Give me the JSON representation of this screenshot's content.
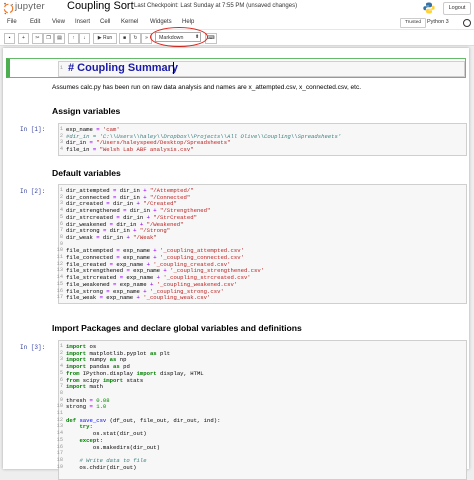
{
  "header": {
    "logo_text": "jupyter",
    "notebook_name": "Coupling Sort",
    "checkpoint": "Last Checkpoint: Last Sunday at 7:55 PM  (unsaved changes)",
    "logout": "Logout"
  },
  "menubar": {
    "items": [
      "File",
      "Edit",
      "View",
      "Insert",
      "Cell",
      "Kernel",
      "Widgets",
      "Help"
    ],
    "trusted": "Trusted",
    "kernel": "Python 3"
  },
  "toolbar": {
    "run_label": "Run",
    "cell_type": "Markdown",
    "highlight_color": "#d9261c"
  },
  "cells": {
    "title": "# Coupling Summary",
    "intro": "Assumes calc.py has been run on raw data analysis and names are x_attempted.csv, x_connected.csv, etc.",
    "h_assign": "Assign variables",
    "h_default": "Default variables",
    "h_import": "Import Packages and declare global variables and definitions",
    "prompt1": "In [1]:",
    "prompt2": "In [2]:",
    "prompt3": "In [3]:",
    "code1": [
      "exp_name = 'cam'",
      "#dir_in = 'C:\\\\Users\\\\haley\\\\Dropbox\\\\Projects\\\\All Olive\\\\Coupling\\\\Spreadsheets'",
      "dir_in = \"/Users/haleyspeed/Desktop/Spreadsheets\"",
      "file_in = \"Welsh Lab ABF analysis.csv\""
    ],
    "code2": [
      "dir_attempted = dir_in + \"/Attempted/\"",
      "dir_connected = dir_in + \"/Connected\"",
      "dir_created = dir_in + \"/Created\"",
      "dir_strengthened = dir_in + \"/Strengthened\"",
      "dir_strcreated = dir_in + \"/StrCreated\"",
      "dir_weakened = dir_in + \"/Weakened\"",
      "dir_strong = dir_in + \"/Strong\"",
      "dir_weak = dir_in + \"/Weak\"",
      "",
      "file_attempted = exp_name + '_coupling_attempted.csv'",
      "file_connected = exp_name + '_coupling_connected.csv'",
      "file_created = exp_name + '_coupling_created.csv'",
      "file_strengthened = exp_name + '_coupling_strengthened.csv'",
      "file_strcreated = exp_name + '_coupling_strcreated.csv'",
      "file_weakened = exp_name + '_coupling_weakened.csv'",
      "file_strong = exp_name + '_coupling_strong.csv'",
      "file_weak = exp_name + '_coupling_weak.csv'"
    ],
    "code3": [
      "import os",
      "import matplotlib.pyplot as plt",
      "import numpy as np",
      "import pandas as pd",
      "from IPython.display import display, HTML",
      "from scipy import stats",
      "import math",
      "",
      "thresh = 0.08",
      "strong = 1.0",
      "",
      "def save_csv (df_out, file_out, dir_out, ind):",
      "    try:",
      "        os.stat(dir_out)",
      "    except:",
      "        os.makedirs(dir_out)",
      "",
      "    # Write data to file",
      "    os.chdir(dir_out)"
    ]
  }
}
